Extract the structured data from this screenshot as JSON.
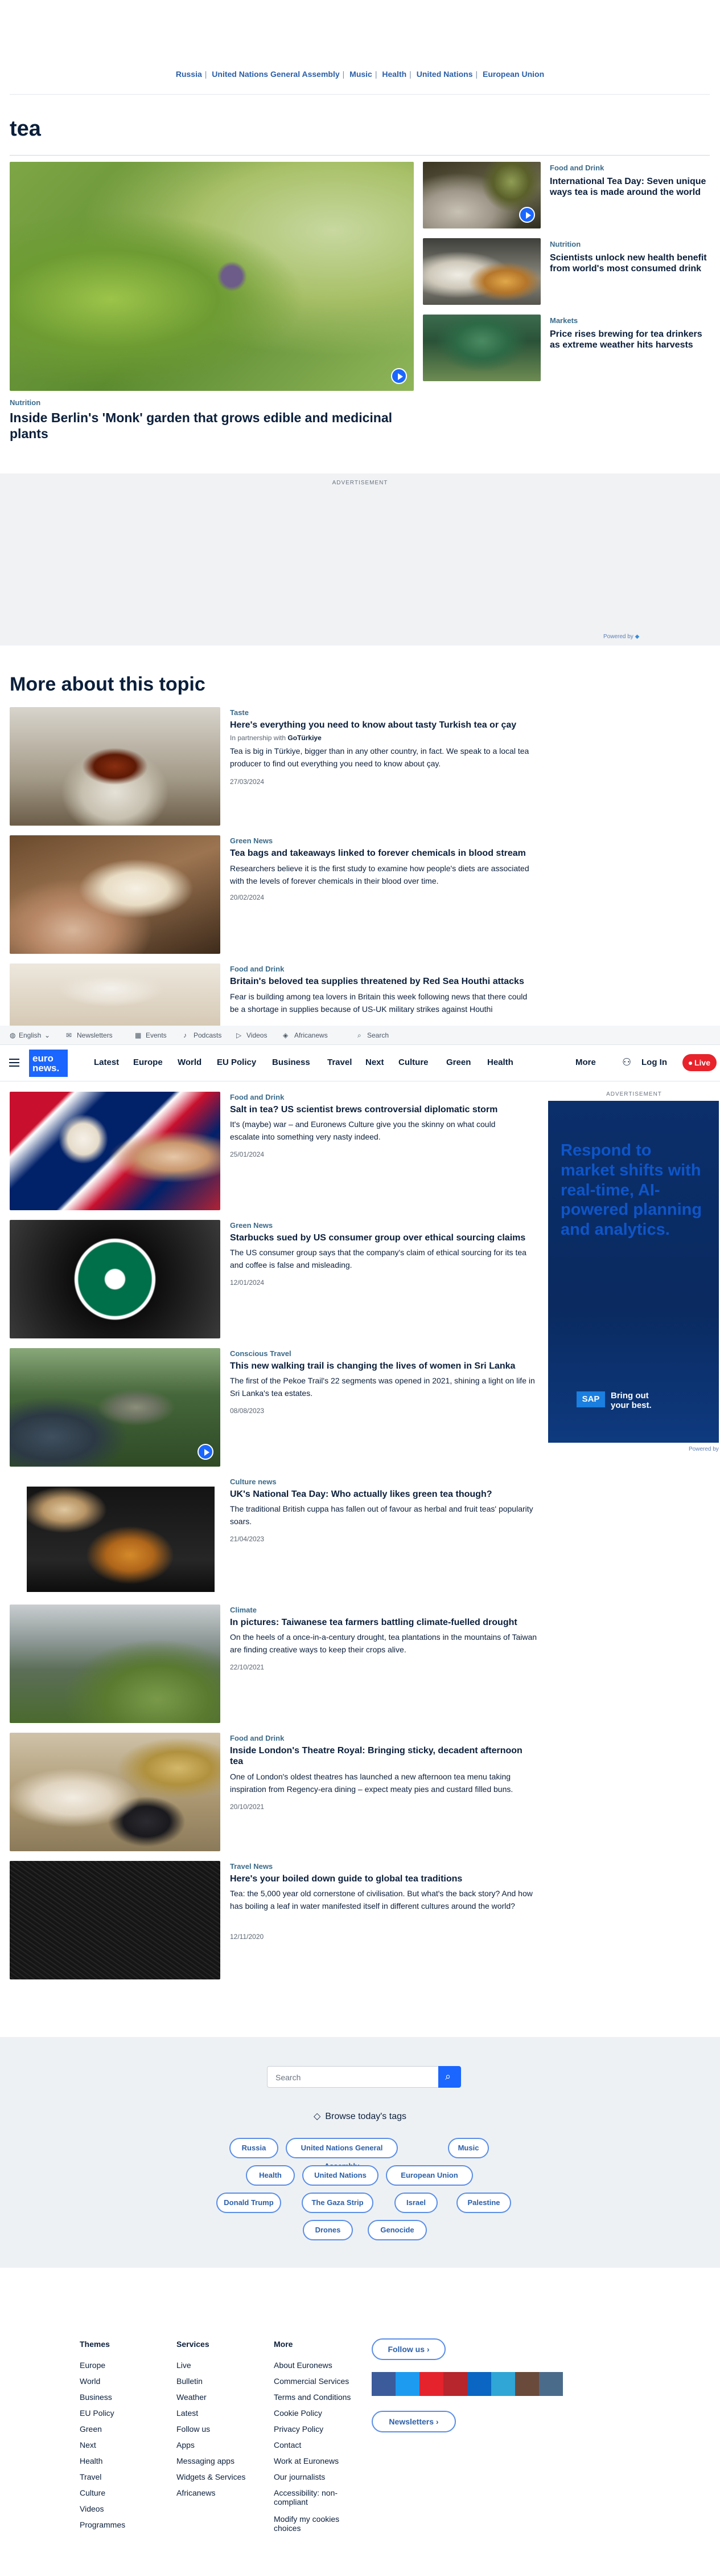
{
  "top_nav": [
    "Russia",
    "United Nations General Assembly",
    "Music",
    "Health",
    "United Nations",
    "European Union"
  ],
  "page_title": "tea",
  "hero": {
    "category": "Nutrition",
    "title": "Inside Berlin's 'Monk' garden that grows edible and medicinal plants"
  },
  "side_stories": [
    {
      "category": "Food and Drink",
      "title": "International Tea Day: Seven unique ways tea is made around the world"
    },
    {
      "category": "Nutrition",
      "title": "Scientists unlock new health benefit from world's most consumed drink"
    },
    {
      "category": "Markets",
      "title": "Price rises brewing for tea drinkers as extreme weather hits harvests"
    }
  ],
  "ad": {
    "label": "ADVERTISEMENT",
    "powered_by": "Powered by"
  },
  "more_heading": "More about this topic",
  "articles": [
    {
      "category": "Taste",
      "title": "Here's everything you need to know about tasty Turkish tea or çay",
      "partner": "In partnership with",
      "partner_name": "GoTürkiye",
      "summary": "Tea is big in Türkiye, bigger than in any other country, in fact. We speak to a local tea producer to find out everything you need to know about çay.",
      "date": "27/03/2024"
    },
    {
      "category": "Green News",
      "title": "Tea bags and takeaways linked to forever chemicals in blood stream",
      "summary": "Researchers believe it is the first study to examine how people's diets are associated with the levels of forever chemicals in their blood over time.",
      "date": "20/02/2024"
    },
    {
      "category": "Food and Drink",
      "title": "Britain's beloved tea supplies threatened by Red Sea Houthi attacks",
      "summary": "Fear is building among tea lovers in Britain this week following news that there could be a shortage in supplies because of US-UK military strikes against Houthi",
      "date": ""
    },
    {
      "category": "Food and Drink",
      "title": "Salt in tea? US scientist brews controversial diplomatic storm",
      "summary": "It's (maybe) war – and Euronews Culture give you the skinny on what could escalate into something very nasty indeed.",
      "date": "25/01/2024"
    },
    {
      "category": "Green News",
      "title": "Starbucks sued by US consumer group over ethical sourcing claims",
      "summary": "The US consumer group says that the company's claim of ethical sourcing for its tea and coffee is false and misleading.",
      "date": "12/01/2024"
    },
    {
      "category": "Conscious Travel",
      "title": "This new walking trail is changing the lives of women in Sri Lanka",
      "summary": "The first of the Pekoe Trail's 22 segments was opened in 2021, shining a light on life in Sri Lanka's tea estates.",
      "date": "08/08/2023"
    },
    {
      "category": "Culture news",
      "title": "UK's National Tea Day: Who actually likes green tea though?",
      "summary": "The traditional British cuppa has fallen out of favour as herbal and fruit teas' popularity soars.",
      "date": "21/04/2023"
    },
    {
      "category": "Climate",
      "title": "In pictures: Taiwanese tea farmers battling climate-fuelled drought",
      "summary": "On the heels of a once-in-a-century drought, tea plantations in the mountains of Taiwan are finding creative ways to keep their crops alive.",
      "date": "22/10/2021"
    },
    {
      "category": "Food and Drink",
      "title": "Inside London's Theatre Royal: Bringing sticky, decadent afternoon tea",
      "summary": "One of London's oldest theatres has launched a new afternoon tea menu taking inspiration from Regency-era dining – expect meaty pies and custard filled buns.",
      "date": "20/10/2021"
    },
    {
      "category": "Travel News",
      "title": "Here's your boiled down guide to global tea traditions",
      "summary": "Tea: the 5,000 year old cornerstone of civilisation. But what's the back story? And how has boiling a leaf in water manifested itself in different cultures around the world?",
      "date": "12/11/2020"
    }
  ],
  "util_bar": {
    "lang": "English",
    "newsletters": "Newsletters",
    "events": "Events",
    "podcasts": "Podcasts",
    "videos": "Videos",
    "africanews": "Africanews",
    "search": "Search"
  },
  "main_nav": {
    "logo_top": "euro",
    "logo_bottom": "news.",
    "items": [
      "Latest",
      "Europe",
      "World",
      "EU Policy",
      "Business",
      "Travel",
      "Next",
      "Culture",
      "Green",
      "Health"
    ],
    "more": "More",
    "login": "Log In",
    "live": "Live"
  },
  "side_ad": {
    "label": "ADVERTISEMENT",
    "headline": "Respond to market shifts with real-time, AI-powered planning and analytics.",
    "brand": "SAP",
    "tagline": "Bring out your best.",
    "powered_by": "Powered by"
  },
  "search": {
    "placeholder": "Search"
  },
  "tags": {
    "heading": "Browse today's tags",
    "items": [
      "Russia",
      "United Nations General Assembly",
      "Music",
      "Health",
      "United Nations",
      "European Union",
      "Donald Trump",
      "The Gaza Strip",
      "Israel",
      "Palestine",
      "Drones",
      "Genocide"
    ]
  },
  "footer": {
    "themes_title": "Themes",
    "themes": [
      "Europe",
      "World",
      "Business",
      "EU Policy",
      "Green",
      "Next",
      "Health",
      "Travel",
      "Culture",
      "Videos",
      "Programmes"
    ],
    "services_title": "Services",
    "services": [
      "Live",
      "Bulletin",
      "Weather",
      "Latest",
      "Follow us",
      "Apps",
      "Messaging apps",
      "Widgets & Services",
      "Africanews"
    ],
    "more_title": "More",
    "more": [
      "About Euronews",
      "Commercial Services",
      "Terms and Conditions",
      "Cookie Policy",
      "Privacy Policy",
      "Contact",
      "Work at Euronews",
      "Our journalists",
      "Accessibility: non-compliant",
      "Modify my cookies choices"
    ],
    "follow_us": "Follow us",
    "newsletters": "Newsletters"
  },
  "colors": {
    "accent": "#1a66ff",
    "live": "#e8232b",
    "navy": "#0b1f3b",
    "category": "#3b6b8a"
  }
}
